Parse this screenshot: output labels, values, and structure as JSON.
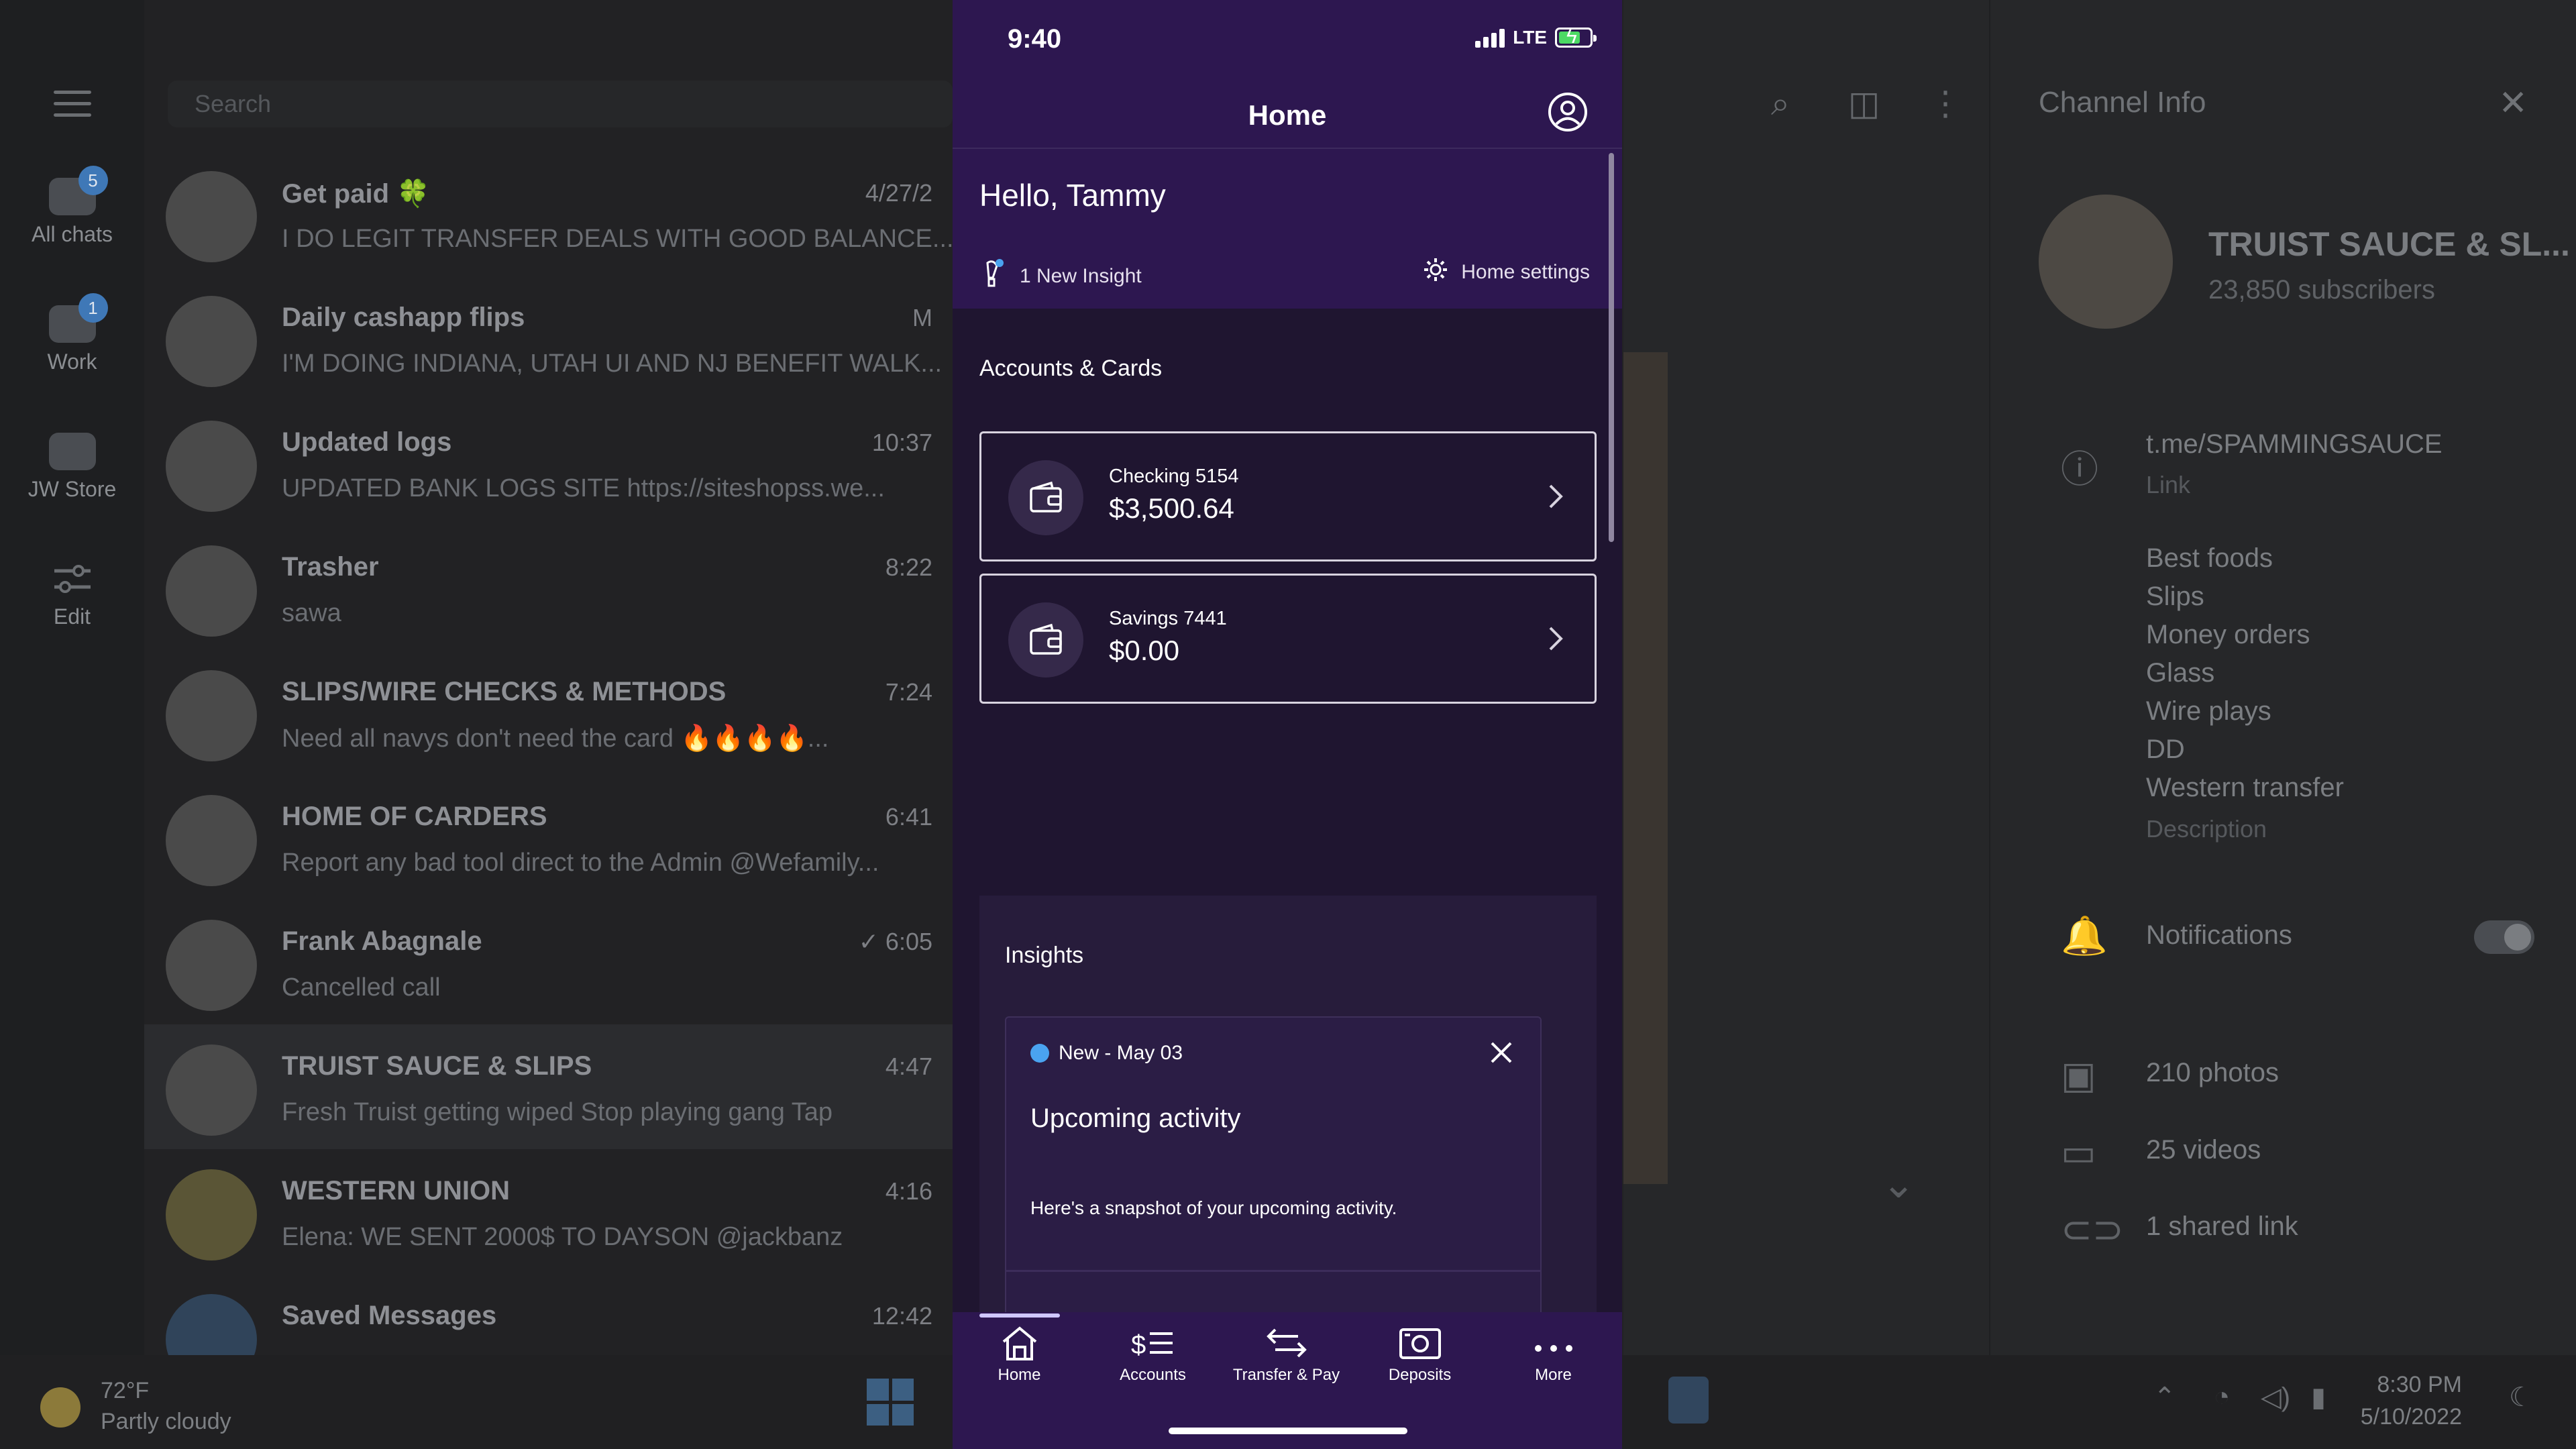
{
  "desktop": {
    "search_placeholder": "Search",
    "folders": [
      {
        "label": "All chats",
        "badge": "5"
      },
      {
        "label": "Work",
        "badge": "1"
      },
      {
        "label": "JW Store",
        "badge": ""
      },
      {
        "label": "Edit",
        "badge": ""
      }
    ],
    "chats": [
      {
        "name": "Get paid 🍀",
        "time": "4/27/2",
        "preview": "I DO  LEGIT TRANSFER DEALS WITH  GOOD BALANCE..."
      },
      {
        "name": "Daily cashapp flips",
        "time": "M",
        "preview": "I'M DOING INDIANA, UTAH UI AND NJ BENEFIT WALK..."
      },
      {
        "name": "Updated logs",
        "time": "10:37",
        "preview": "UPDATED BANK LOGS SITE https://siteshopss.we..."
      },
      {
        "name": "Trasher",
        "time": "8:22",
        "preview": "sawa"
      },
      {
        "name": "SLIPS/WIRE CHECKS & METHODS",
        "time": "7:24",
        "preview": "Need all navys don't need the card 🔥🔥🔥🔥..."
      },
      {
        "name": "HOME OF CARDERS",
        "time": "6:41",
        "preview": "Report any bad tool direct to the Admin @Wefamily..."
      },
      {
        "name": "Frank Abagnale",
        "time": "✓ 6:05",
        "preview": "Cancelled call"
      },
      {
        "name": "TRUIST SAUCE & SLIPS",
        "time": "4:47",
        "preview": "Fresh Truist getting wiped Stop playing gang Tap"
      },
      {
        "name": "WESTERN UNION",
        "time": "4:16",
        "preview": "Elena: WE SENT 2000$ TO DAYSON @jackbanz"
      },
      {
        "name": "Saved Messages",
        "time": "12:42",
        "preview": ""
      }
    ],
    "channel_info": {
      "title": "Channel Info",
      "name": "TRUIST SAUCE & SL...",
      "subscribers": "23,850 subscribers",
      "link": "t.me/SPAMMINGSAUCE",
      "link_label": "Link",
      "description_lines": [
        "Best foods",
        "Slips",
        "Money orders",
        "Glass",
        "Wire plays",
        "DD",
        "Western transfer"
      ],
      "description_label": "Description",
      "notifications": "Notifications",
      "photos": "210 photos",
      "videos": "25 videos",
      "links": "1 shared link"
    },
    "taskbar": {
      "temp": "72°F",
      "weather": "Partly cloudy",
      "time": "8:30 PM",
      "date": "5/10/2022"
    }
  },
  "phone": {
    "status": {
      "time": "9:40",
      "network": "LTE"
    },
    "nav_title": "Home",
    "greeting": "Hello, Tammy",
    "insight_link": "1 New Insight",
    "settings_link": "Home settings",
    "accounts_label": "Accounts & Cards",
    "accounts": [
      {
        "name": "Checking 5154",
        "balance": "$3,500.64"
      },
      {
        "name": "Savings 7441",
        "balance": "$0.00"
      }
    ],
    "insights": {
      "title": "Insights",
      "card_tag": "New - May 03",
      "card_title": "Upcoming activity",
      "card_body": "Here's a snapshot of your upcoming activity."
    },
    "tabs": [
      {
        "label": "Home",
        "icon": "home-icon"
      },
      {
        "label": "Accounts",
        "icon": "accounts-icon"
      },
      {
        "label": "Transfer & Pay",
        "icon": "transfer-icon"
      },
      {
        "label": "Deposits",
        "icon": "deposits-icon"
      },
      {
        "label": "More",
        "icon": "more-icon"
      }
    ],
    "colors": {
      "header": "#2d1750",
      "background": "#1f1530",
      "insight_dot": "#4aa3f0"
    }
  }
}
